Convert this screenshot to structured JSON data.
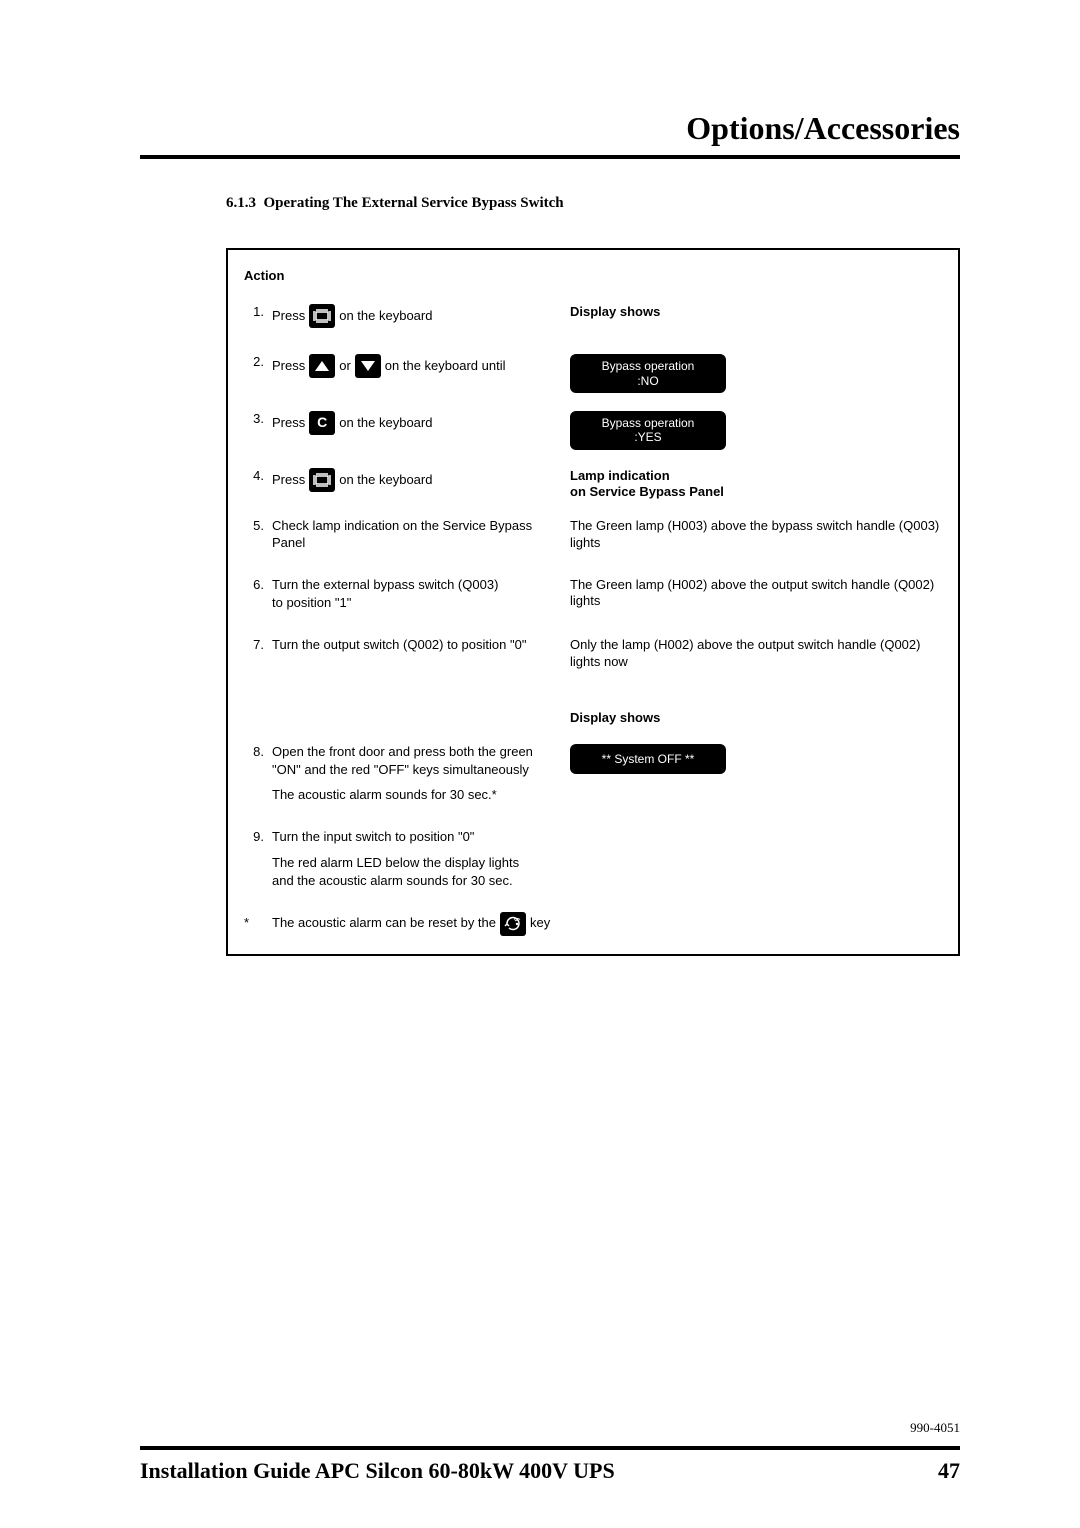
{
  "header": {
    "title": "Options/Accessories"
  },
  "section": {
    "number": "6.1.3",
    "title": "Operating The External Service Bypass Switch"
  },
  "action_heading": "Action",
  "display_shows_label": "Display shows",
  "lamp_heading_l1": "Lamp indication",
  "lamp_heading_l2": "on Service Bypass Panel",
  "steps": {
    "s1": {
      "n": "1.",
      "pre": "Press",
      "post": "on the keyboard"
    },
    "s2": {
      "n": "2.",
      "pre": "Press",
      "mid": "or",
      "post": "on the keyboard until",
      "lcd_l1": "Bypass operation",
      "lcd_l2": ":NO"
    },
    "s3": {
      "n": "3.",
      "pre": "Press",
      "key": "C",
      "post": "on the keyboard",
      "lcd_l1": "Bypass operation",
      "lcd_l2": ":YES"
    },
    "s4": {
      "n": "4.",
      "pre": "Press",
      "post": "on the keyboard"
    },
    "s5": {
      "n": "5.",
      "text": "Check lamp indication on the Service Bypass Panel",
      "right": "The Green lamp (H003) above the bypass switch handle (Q003) lights"
    },
    "s6": {
      "n": "6.",
      "l1": "Turn the external bypass switch (Q003)",
      "l2": "to position \"1\"",
      "right": "The Green lamp (H002) above the output switch handle (Q002) lights"
    },
    "s7": {
      "n": "7.",
      "text": "Turn the output switch (Q002) to position \"0\"",
      "right": "Only the lamp (H002) above the output switch handle (Q002) lights now"
    },
    "s8": {
      "n": "8.",
      "l1": "Open the front door and press both the green",
      "l2": "\"ON\" and the red \"OFF\" keys simultaneously",
      "note": "The acoustic alarm sounds for 30 sec.*",
      "lcd": "** System OFF **"
    },
    "s9": {
      "n": "9.",
      "l1": "Turn the input switch to position \"0\"",
      "note_l1": "The red alarm LED below the display lights",
      "note_l2": "and the acoustic alarm sounds for 30 sec."
    }
  },
  "footnote": {
    "star": "*",
    "pre": "The acoustic alarm can be reset by the",
    "post": "key"
  },
  "docnum": "990-4051",
  "footer": {
    "title": "Installation Guide APC Silcon 60-80kW 400V UPS",
    "page": "47"
  }
}
